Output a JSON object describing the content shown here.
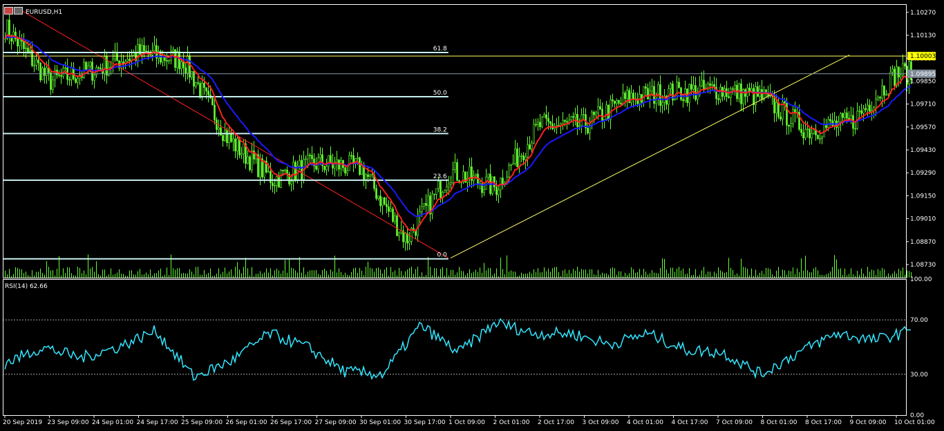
{
  "header": {
    "symbol_title": "EURUSD,H1",
    "rsi_title": "RSI(14) 62.66"
  },
  "colors": {
    "background": "#000000",
    "frame": "#ffffff",
    "candles": "#66ff33",
    "volume": "#66ff33",
    "ma_fast": "#ff2020",
    "ma_slow": "#1a1aff",
    "rsi_line": "#33e6ff",
    "fib_lines": "#c8f0f0",
    "fib_base": "#ff2020",
    "trendline": "#ffff66",
    "resistance": "#ffff66",
    "price_badge_bg": "#ffff00",
    "bid_badge_bg": "#7f8c99"
  },
  "chart_data": [
    {
      "type": "candlestick",
      "symbol": "EURUSD",
      "timeframe": "H1",
      "ylim": [
        1.0865,
        1.1032
      ],
      "price_ticks": [
        "1.10270",
        "1.10130",
        "1.09990",
        "1.09850",
        "1.09710",
        "1.09570",
        "1.09430",
        "1.09290",
        "1.09150",
        "1.09010",
        "1.08870",
        "1.08730"
      ],
      "time_ticks": [
        "20 Sep 2019",
        "23 Sep 09:00",
        "24 Sep 01:00",
        "24 Sep 17:00",
        "25 Sep 09:00",
        "26 Sep 01:00",
        "26 Sep 17:00",
        "27 Sep 09:00",
        "30 Sep 01:00",
        "30 Sep 17:00",
        "1 Oct 09:00",
        "2 Oct 01:00",
        "2 Oct 17:00",
        "3 Oct 09:00",
        "4 Oct 01:00",
        "4 Oct 17:00",
        "7 Oct 09:00",
        "8 Oct 01:00",
        "8 Oct 17:00",
        "9 Oct 09:00",
        "10 Oct 01:00"
      ],
      "close_path_by_tick": [
        1.1018,
        1.0985,
        1.0992,
        1.1002,
        1.0998,
        1.095,
        1.0925,
        1.0935,
        1.0932,
        1.0888,
        1.093,
        1.092,
        1.0958,
        1.0958,
        1.0975,
        1.0978,
        1.098,
        1.0975,
        1.0955,
        1.096,
        1.099
      ],
      "overlays": [
        {
          "name": "MA fast",
          "color": "#ff2020"
        },
        {
          "name": "MA slow",
          "color": "#1a1aff"
        }
      ],
      "fibonacci": {
        "levels": [
          {
            "label": "61.8",
            "price": 1.10025
          },
          {
            "label": "50.0",
            "price": 1.09755
          },
          {
            "label": "38.2",
            "price": 1.0953
          },
          {
            "label": "23.6",
            "price": 1.09245
          },
          {
            "label": "0.0",
            "price": 1.08765
          }
        ],
        "base_from": {
          "time_index": 0.25,
          "price": 1.103
        },
        "base_to": {
          "time_index": 9.95,
          "price": 1.0877
        }
      },
      "trendline": {
        "from": {
          "time_index": 10.0,
          "price": 1.0877
        },
        "to": {
          "time_index": 18.95,
          "price": 1.1001
        }
      },
      "resistance": {
        "price": 1.10003,
        "label": "1.10003",
        "from_time_index": 9.95
      },
      "bid": {
        "price": 1.09895,
        "label": "1.09895"
      }
    },
    {
      "type": "line",
      "name": "RSI(14)",
      "value": 62.66,
      "ylim": [
        0,
        100
      ],
      "levels": [
        70,
        30
      ],
      "tick_labels": [
        "100.00",
        "70.00",
        "30.00",
        "0.00"
      ],
      "path_by_tick": [
        38,
        50,
        42,
        50,
        62,
        28,
        40,
        60,
        50,
        32,
        30,
        66,
        46,
        68,
        60,
        60,
        52,
        60,
        48,
        46,
        30,
        46,
        60,
        55,
        62
      ]
    }
  ]
}
